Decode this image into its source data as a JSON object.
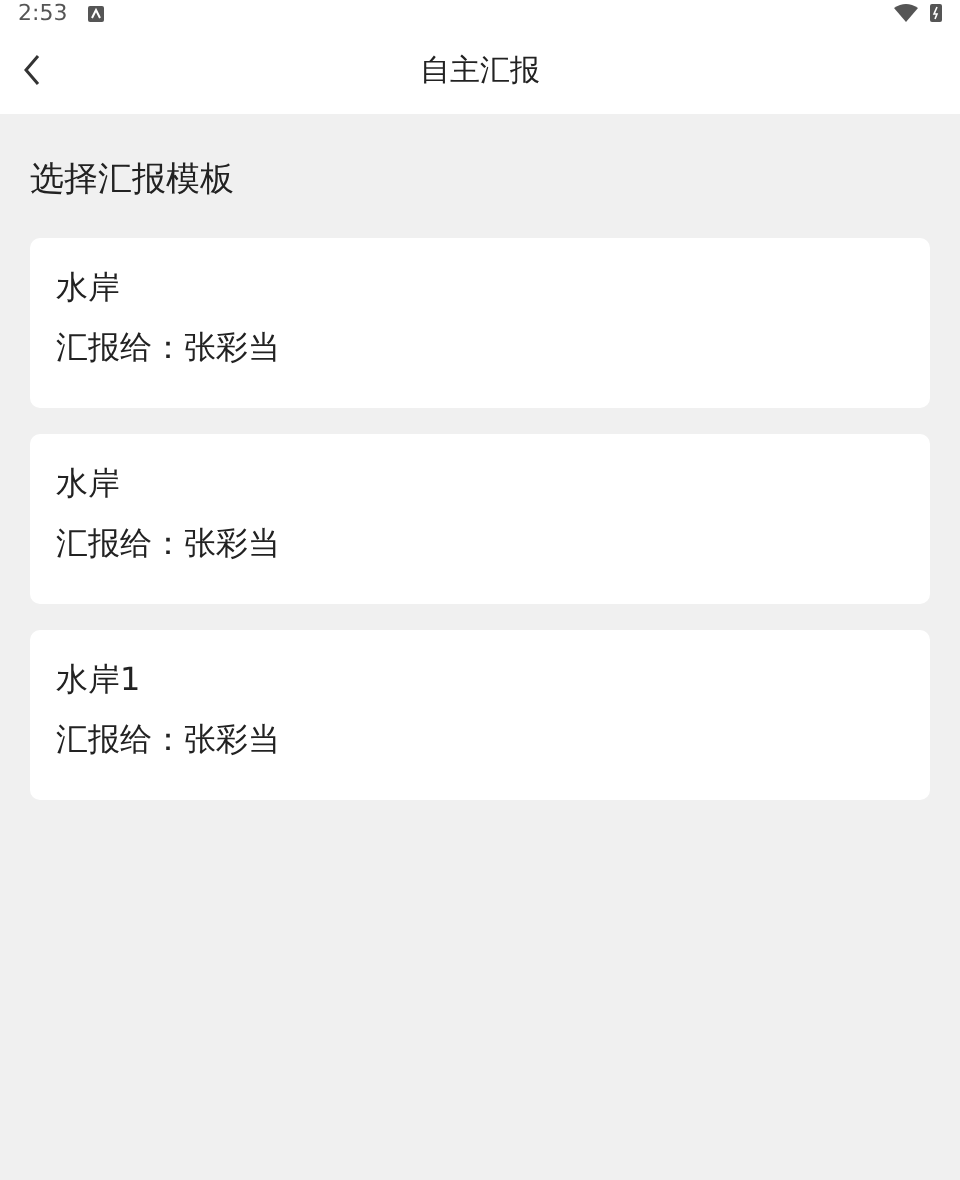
{
  "status_bar": {
    "time": "2:53"
  },
  "app_bar": {
    "title": "自主汇报"
  },
  "section_title": "选择汇报模板",
  "templates": [
    {
      "name": "水岸",
      "recipient": "汇报给：张彩当"
    },
    {
      "name": "水岸",
      "recipient": "汇报给：张彩当"
    },
    {
      "name": "水岸1",
      "recipient": "汇报给：张彩当"
    }
  ]
}
